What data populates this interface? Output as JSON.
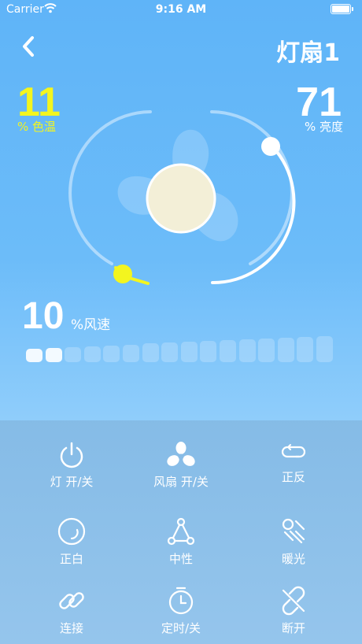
{
  "status_bar": {
    "carrier": "Carrier",
    "time": "9:16 AM"
  },
  "header": {
    "title": "灯扇1"
  },
  "color_temp": {
    "value": "11",
    "unit": "% 色温",
    "color": "#f3f51f"
  },
  "brightness": {
    "value": "71",
    "unit": "% 亮度"
  },
  "fan_speed": {
    "value": "10",
    "unit": "%风速",
    "level": 0.1,
    "segments_total": 16,
    "segments_on": 2
  },
  "controls": [
    {
      "id": "light",
      "label": "灯 开/关",
      "icon": "power-icon"
    },
    {
      "id": "fan",
      "label": "风扇 开/关",
      "icon": "fan-icon"
    },
    {
      "id": "reverse",
      "label": "正反",
      "icon": "loop-icon"
    },
    {
      "id": "white",
      "label": "正白",
      "icon": "circle-arc-icon"
    },
    {
      "id": "neutral",
      "label": "中性",
      "icon": "triangle-nodes-icon"
    },
    {
      "id": "warm",
      "label": "暖光",
      "icon": "warm-light-icon"
    },
    {
      "id": "connect",
      "label": "连接",
      "icon": "link-icon"
    },
    {
      "id": "timer",
      "label": "定时/关",
      "icon": "timer-icon"
    },
    {
      "id": "disconnect",
      "label": "断开",
      "icon": "unlink-icon"
    }
  ]
}
